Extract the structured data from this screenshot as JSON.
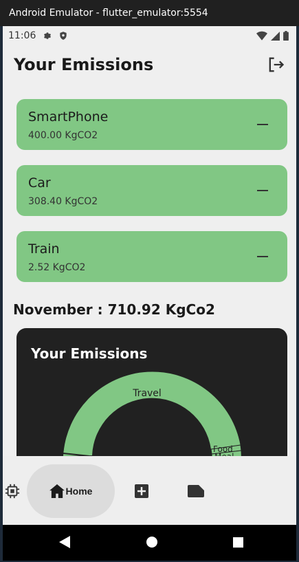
{
  "window": {
    "title": "Android Emulator - flutter_emulator:5554"
  },
  "status_bar": {
    "time": "11:06"
  },
  "app_bar": {
    "title": "Your Emissions"
  },
  "emissions": [
    {
      "name": "SmartPhone",
      "amount": "400.00 KgCO2"
    },
    {
      "name": "Car",
      "amount": "308.40 KgCO2"
    },
    {
      "name": "Train",
      "amount": "2.52 KgCO2"
    }
  ],
  "summary": {
    "text": "November : 710.92 KgCo2"
  },
  "chart_card": {
    "title": "Your Emissions"
  },
  "chart_data": {
    "type": "pie",
    "title": "Your Emissions",
    "categories": [
      "Travel",
      "Food",
      "Meal"
    ],
    "labels_visible": [
      "Travel",
      "Food",
      "Meal"
    ],
    "color": "#81c784",
    "style": "donut"
  },
  "bottom_nav": {
    "items": [
      {
        "label": "Home",
        "icon": "home-icon",
        "selected": true
      },
      {
        "label": "",
        "icon": "add-box-icon",
        "selected": false
      },
      {
        "label": "",
        "icon": "folder-icon",
        "selected": false
      },
      {
        "label": "",
        "icon": "chip-icon",
        "selected": false
      }
    ]
  },
  "colors": {
    "card": "#81c784",
    "chart_bg": "#212121",
    "page_bg": "#efefef"
  }
}
